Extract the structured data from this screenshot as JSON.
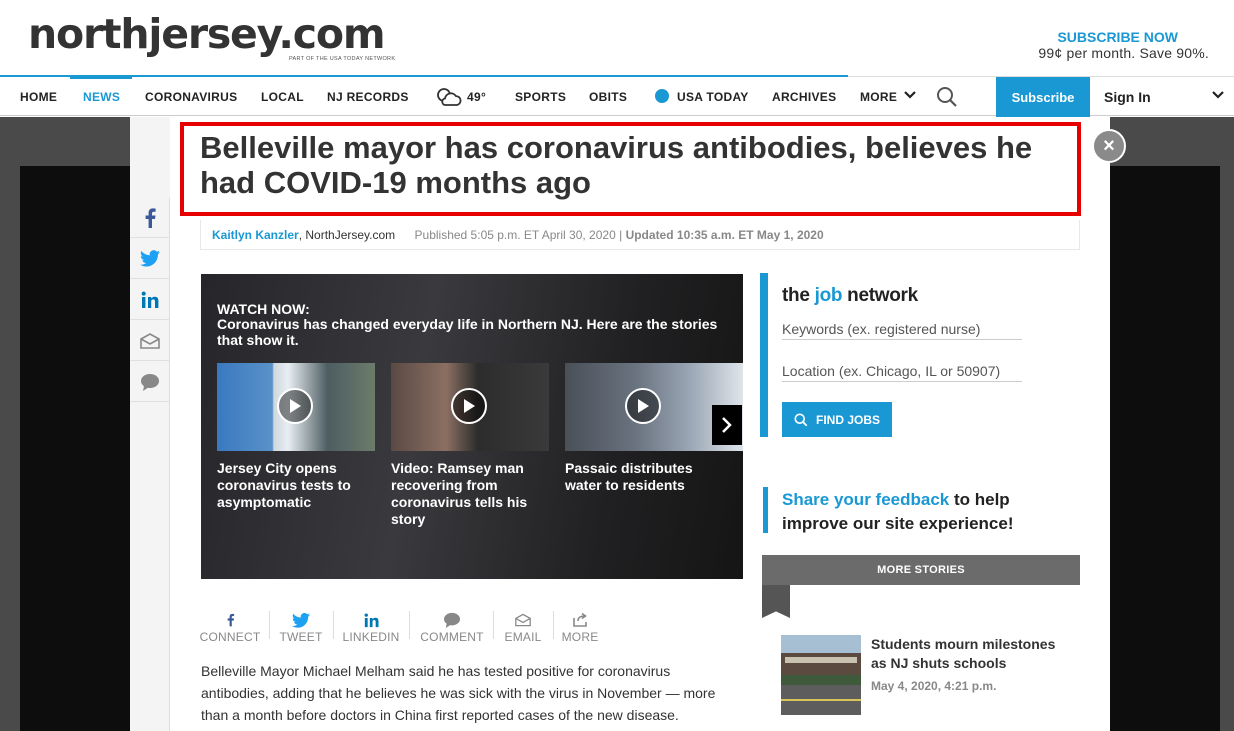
{
  "header": {
    "logo": "northjersey.com",
    "logo_sub": "PART OF THE USA TODAY NETWORK",
    "subscribe_now": "SUBSCRIBE NOW",
    "price": "99¢ per month. Save 90%."
  },
  "nav": {
    "items": {
      "home": "HOME",
      "news": "NEWS",
      "coronavirus": "CORONAVIRUS",
      "local": "LOCAL",
      "nj_records": "NJ RECORDS",
      "weather": "49°",
      "sports": "SPORTS",
      "obits": "OBITS",
      "usa_today": "USA TODAY",
      "archives": "ARCHIVES",
      "more": "MORE"
    },
    "subscribe": "Subscribe",
    "signin": "Sign In"
  },
  "article": {
    "headline": "Belleville mayor has coronavirus antibodies, believes he had COVID-19 months ago",
    "author": "Kaitlyn Kanzler",
    "outlet": ", NorthJersey.com",
    "published": "Published 5:05 p.m. ET April 30, 2020 |",
    "updated": "Updated 10:35 a.m. ET May 1, 2020",
    "body": "Belleville Mayor Michael Melham said he has tested positive for coronavirus antibodies, adding that he believes he was sick with the virus in November — more than a month before doctors in China first reported cases of the new disease."
  },
  "close_label": "×",
  "video": {
    "watch": "WATCH NOW:",
    "desc": "Coronavirus has changed everyday life in Northern NJ. Here are the stories that show it.",
    "items": [
      {
        "caption": "Jersey City opens coronavirus tests to asymptomatic"
      },
      {
        "caption": "Video: Ramsey man recovering from coronavirus tells his story"
      },
      {
        "caption": "Passaic distributes water to residents"
      }
    ]
  },
  "share": {
    "connect": "CONNECT",
    "tweet": "TWEET",
    "linkedin": "LINKEDIN",
    "comment": "COMMENT",
    "email": "EMAIL",
    "more": "MORE"
  },
  "jobs": {
    "logo_the": "the ",
    "logo_job": "job",
    "logo_network": " network",
    "keywords_placeholder": "Keywords (ex. registered nurse)",
    "location_placeholder": "Location (ex. Chicago, IL or 50907)",
    "find_jobs": "FIND JOBS"
  },
  "feedback": {
    "link": "Share your feedback",
    "rest": " to help improve our site experience!"
  },
  "more_stories": {
    "header": "MORE STORIES",
    "story_title": "Students mourn milestones as NJ shuts schools",
    "story_date": "May 4, 2020, 4:21 p.m."
  },
  "colors": {
    "accent": "#1a98d4",
    "highlight_box": "#e60000"
  }
}
